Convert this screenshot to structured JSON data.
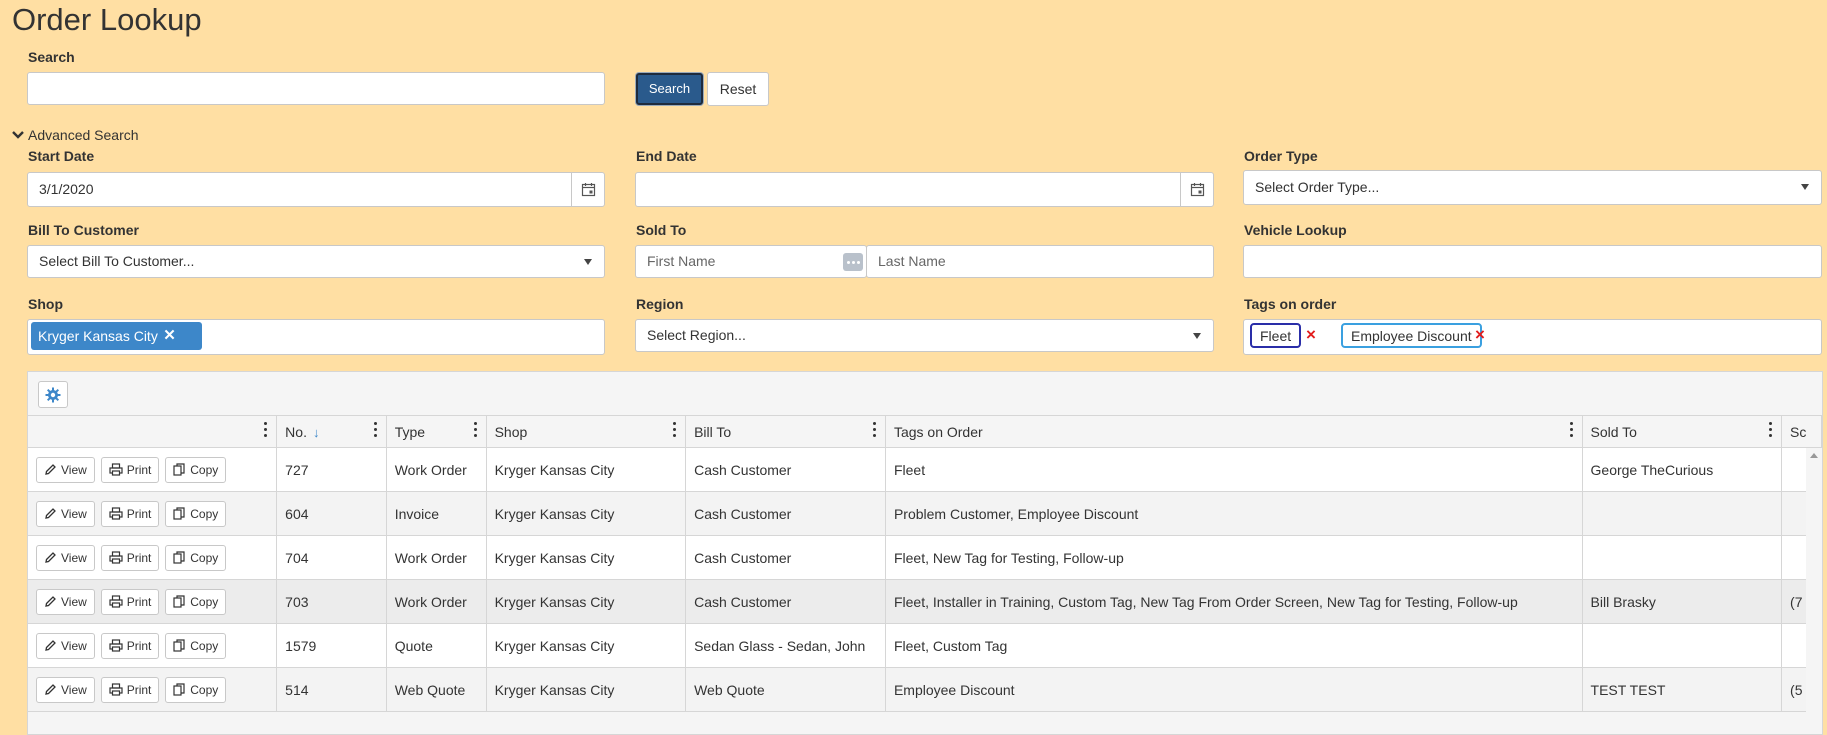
{
  "page": {
    "title": "Order Lookup"
  },
  "search": {
    "label": "Search",
    "value": "",
    "search_button": "Search",
    "reset_button": "Reset"
  },
  "advanced": {
    "toggle_label": "Advanced Search"
  },
  "filters": {
    "start_date": {
      "label": "Start Date",
      "value": "3/1/2020"
    },
    "end_date": {
      "label": "End Date",
      "value": ""
    },
    "order_type": {
      "label": "Order Type",
      "placeholder": "Select Order Type..."
    },
    "bill_to": {
      "label": "Bill To Customer",
      "placeholder": "Select Bill To Customer..."
    },
    "sold_to": {
      "label": "Sold To",
      "first_placeholder": "First Name",
      "last_placeholder": "Last Name"
    },
    "vehicle": {
      "label": "Vehicle Lookup",
      "value": ""
    },
    "shop": {
      "label": "Shop",
      "chip": "Kryger Kansas City"
    },
    "region": {
      "label": "Region",
      "placeholder": "Select Region..."
    },
    "tags": {
      "label": "Tags on order",
      "items": [
        "Fleet",
        "Employee Discount"
      ]
    }
  },
  "grid": {
    "actions": {
      "view": "View",
      "print": "Print",
      "copy": "Copy"
    },
    "columns": [
      "No.",
      "Type",
      "Shop",
      "Bill To",
      "Tags on Order",
      "Sold To",
      "Sc"
    ],
    "rows": [
      {
        "no": "727",
        "type": "Work Order",
        "shop": "Kryger Kansas City",
        "bill_to": "Cash Customer",
        "tags": "Fleet",
        "sold_to": "George TheCurious",
        "extra": ""
      },
      {
        "no": "604",
        "type": "Invoice",
        "shop": "Kryger Kansas City",
        "bill_to": "Cash Customer",
        "tags": "Problem Customer, Employee Discount",
        "sold_to": "",
        "extra": ""
      },
      {
        "no": "704",
        "type": "Work Order",
        "shop": "Kryger Kansas City",
        "bill_to": "Cash Customer",
        "tags": "Fleet, New Tag for Testing, Follow-up",
        "sold_to": "",
        "extra": ""
      },
      {
        "no": "703",
        "type": "Work Order",
        "shop": "Kryger Kansas City",
        "bill_to": "Cash Customer",
        "tags": "Fleet, Installer in Training, Custom Tag, New Tag From Order Screen, New Tag for Testing, Follow-up",
        "sold_to": "Bill Brasky",
        "extra": "(7"
      },
      {
        "no": "1579",
        "type": "Quote",
        "shop": "Kryger Kansas City",
        "bill_to": "Sedan Glass - Sedan, John",
        "tags": "Fleet, Custom Tag",
        "sold_to": "",
        "extra": ""
      },
      {
        "no": "514",
        "type": "Web Quote",
        "shop": "Kryger Kansas City",
        "bill_to": "Web Quote",
        "tags": "Employee Discount",
        "sold_to": "TEST TEST",
        "extra": "(5"
      }
    ]
  }
}
